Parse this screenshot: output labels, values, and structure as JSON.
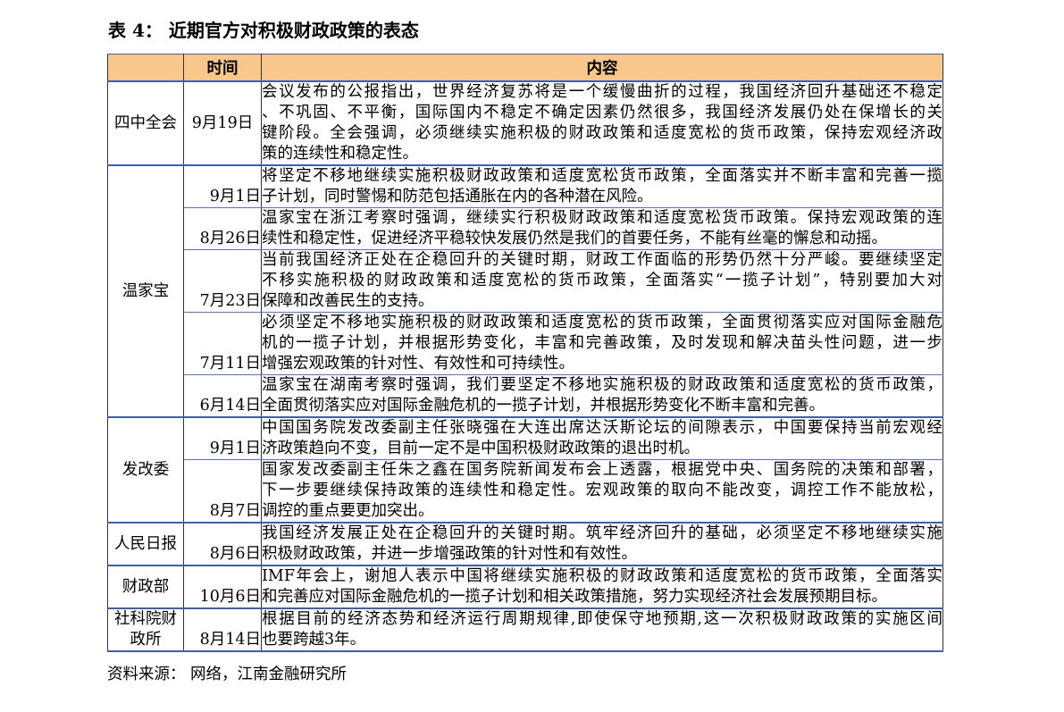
{
  "title": "表 4： 近期官方对积极财政政策的表态",
  "table": {
    "headers": {
      "date": "时间",
      "content": "内容"
    },
    "groups": [
      {
        "source": "四中全会",
        "entries": [
          {
            "date": "9月19日",
            "lines": [
              "会议发布的公报指出，世界经济复苏将是一个缓慢曲折的过程，我国经济回升基础还不稳定",
              "、不巩固、不平衡，国际国内不稳定不确定因素仍然很多，我国经济发展仍处在保增长的关",
              "键阶段。全会强调，必须继续实施积极的财政政策和适度宽松的货币政策，保持宏观经济政",
              "策的连续性和稳定性。"
            ]
          }
        ]
      },
      {
        "source": "温家宝",
        "entries": [
          {
            "date": "9月1日",
            "lines": [
              "将坚定不移地继续实施积极财政政策和适度宽松货币政策，全面落实并不断丰富和完善一揽",
              "子计划，同时警惕和防范包括通胀在内的各种潜在风险。"
            ]
          },
          {
            "date": "8月26日",
            "lines": [
              "温家宝在浙江考察时强调，继续实行积极财政政策和适度宽松货币政策。保持宏观政策的连",
              "续性和稳定性，促进经济平稳较快发展仍然是我们的首要任务，不能有丝毫的懈怠和动摇。"
            ]
          },
          {
            "date": "7月23日",
            "lines": [
              "当前我国经济正处在企稳回升的关键时期，财政工作面临的形势仍然十分严峻。要继续坚定",
              "不移实施积极的财政政策和适度宽松的货币政策，全面落实“一揽子计划”，特别要加大对",
              "保障和改善民生的支持。"
            ]
          },
          {
            "date": "7月11日",
            "lines": [
              "必须坚定不移地实施积极的财政政策和适度宽松的货币政策，全面贯彻落实应对国际金融危",
              "机的一揽子计划，并根据形势变化，丰富和完善政策，及时发现和解决苗头性问题，进一步",
              "增强宏观政策的针对性、有效性和可持续性。"
            ]
          },
          {
            "date": "6月14日",
            "lines": [
              "温家宝在湖南考察时强调，我们要坚定不移地实施积极的财政政策和适度宽松的货币政策，",
              "全面贯彻落实应对国际金融危机的一揽子计划，并根据形势变化不断丰富和完善。"
            ]
          }
        ]
      },
      {
        "source": "发改委",
        "entries": [
          {
            "date": "9月1日",
            "lines": [
              "中国国务院发改委副主任张晓强在大连出席达沃斯论坛的间隙表示，中国要保持当前宏观经",
              "济政策趋向不变，目前一定不是中国积极财政政策的退出时机。"
            ]
          },
          {
            "date": "8月7日",
            "lines": [
              "国家发改委副主任朱之鑫在国务院新闻发布会上透露，根据党中央、国务院的决策和部署，",
              "下一步要继续保持政策的连续性和稳定性。宏观政策的取向不能改变，调控工作不能放松，",
              "调控的重点要更加突出。"
            ]
          }
        ]
      },
      {
        "source": "人民日报",
        "entries": [
          {
            "date": "8月6日",
            "lines": [
              "我国经济发展正处在企稳回升的关键时期。筑牢经济回升的基础，必须坚定不移地继续实施",
              "积极财政政策，并进一步增强政策的针对性和有效性。"
            ]
          }
        ]
      },
      {
        "source": "财政部",
        "entries": [
          {
            "date": "10月6日",
            "lines": [
              "IMF年会上，谢旭人表示中国将继续实施积极的财政政策和适度宽松的货币政策，全面落实",
              "和完善应对国际金融危机的一揽子计划和相关政策措施，努力实现经济社会发展预期目标。"
            ]
          }
        ]
      },
      {
        "source": "社科院财政所",
        "entries": [
          {
            "date": "8月14日",
            "lines": [
              "根据目前的经济态势和经济运行周期规律,即使保守地预期,这一次积极财政政策的实施区间",
              "也要跨越3年。"
            ]
          }
        ]
      }
    ]
  },
  "footer": "资料来源： 网络，江南金融研究所",
  "colors": {
    "header_bg": "#f9c68c",
    "rule": "#3f5fae",
    "subrule": "#5c74b5"
  }
}
